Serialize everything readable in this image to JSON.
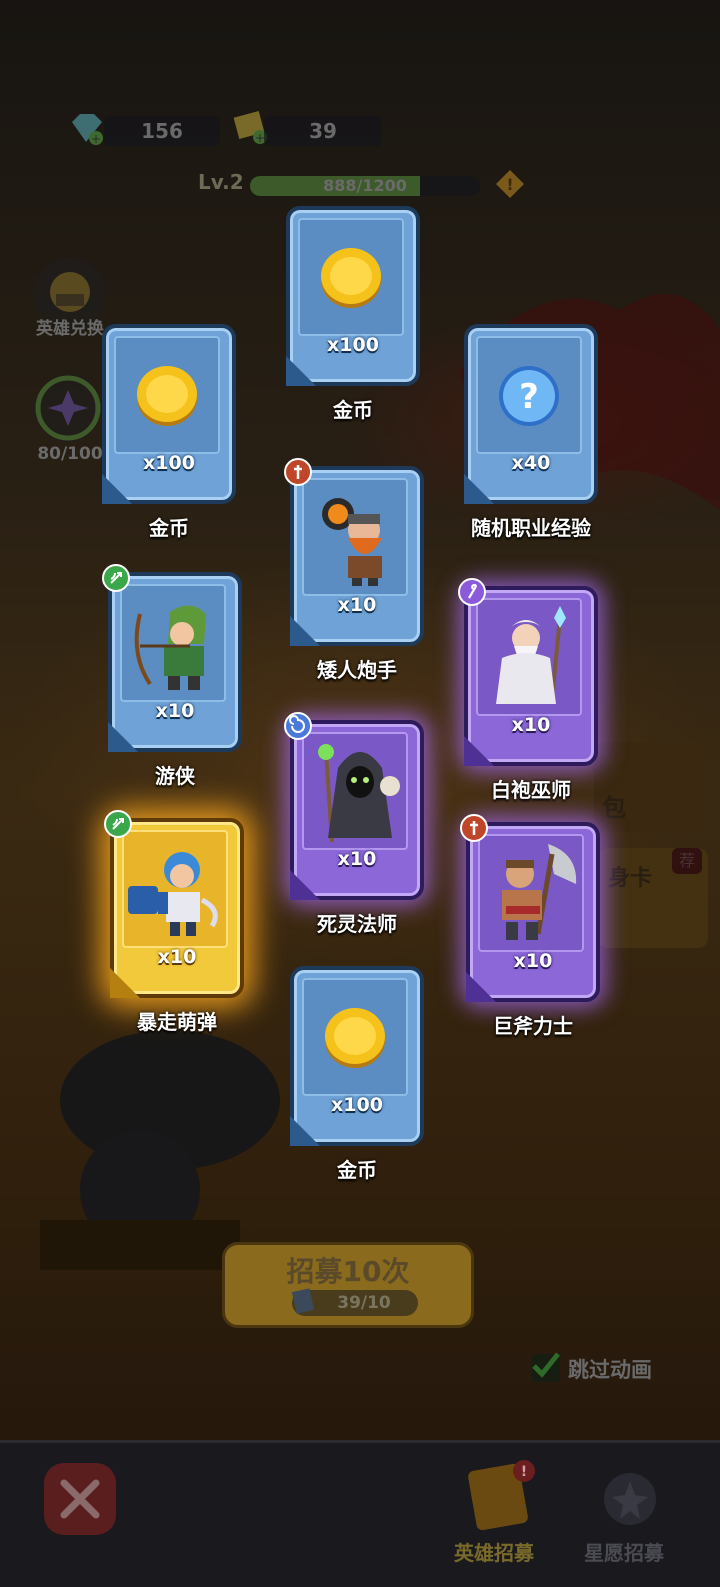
{
  "header": {
    "gems": "156",
    "tickets": "39",
    "level": "Lv.2",
    "exp_text": "888/1200",
    "exp_fraction": 0.74
  },
  "side": {
    "hero_exchange": "英雄兑换",
    "progress": "80/100"
  },
  "cards": [
    {
      "id": "coin-1",
      "qty": "x100",
      "name": "金币",
      "style": "blue",
      "icon": "gold-coin-icon"
    },
    {
      "id": "coin-2",
      "qty": "x100",
      "name": "金币",
      "style": "blue",
      "icon": "gold-coin-icon"
    },
    {
      "id": "class-exp",
      "qty": "x40",
      "name": "随机职业经验",
      "style": "blue",
      "icon": "question-orb-icon"
    },
    {
      "id": "dwarf",
      "qty": "x10",
      "name": "矮人炮手",
      "style": "blue",
      "icon": "dwarf-cannoneer-portrait",
      "badge": "warrior-class-icon"
    },
    {
      "id": "ranger",
      "qty": "x10",
      "name": "游侠",
      "style": "blue",
      "icon": "ranger-portrait",
      "badge": "archer-class-icon"
    },
    {
      "id": "white-wizard",
      "qty": "x10",
      "name": "白袍巫师",
      "style": "purple",
      "icon": "white-wizard-portrait",
      "badge": "mage-class-icon"
    },
    {
      "id": "necromancer",
      "qty": "x10",
      "name": "死灵法师",
      "style": "purple",
      "icon": "necromancer-portrait",
      "badge": "spiral-class-icon"
    },
    {
      "id": "rampage",
      "qty": "x10",
      "name": "暴走萌弹",
      "style": "gold",
      "icon": "rampage-gunner-portrait",
      "badge": "archer-class-icon"
    },
    {
      "id": "axe-giant",
      "qty": "x10",
      "name": "巨斧力士",
      "style": "purple",
      "icon": "axe-warrior-portrait",
      "badge": "warrior-class-icon"
    },
    {
      "id": "coin-3",
      "qty": "x100",
      "name": "金币",
      "style": "blue",
      "icon": "gold-coin-icon"
    }
  ],
  "bg_fragments": {
    "pack": "包",
    "card": "身卡",
    "recommend": "荐"
  },
  "recruit": {
    "button": "招募10次",
    "cost": "39/10"
  },
  "skip": {
    "label": "跳过动画",
    "checked": true
  },
  "tabs": {
    "hero_recruit": "英雄招募",
    "star_recruit": "星愿招募"
  },
  "colors": {
    "blue_card": "#6fa3d8",
    "purple_card": "#8b67d8",
    "gold_card": "#f2c93a"
  }
}
